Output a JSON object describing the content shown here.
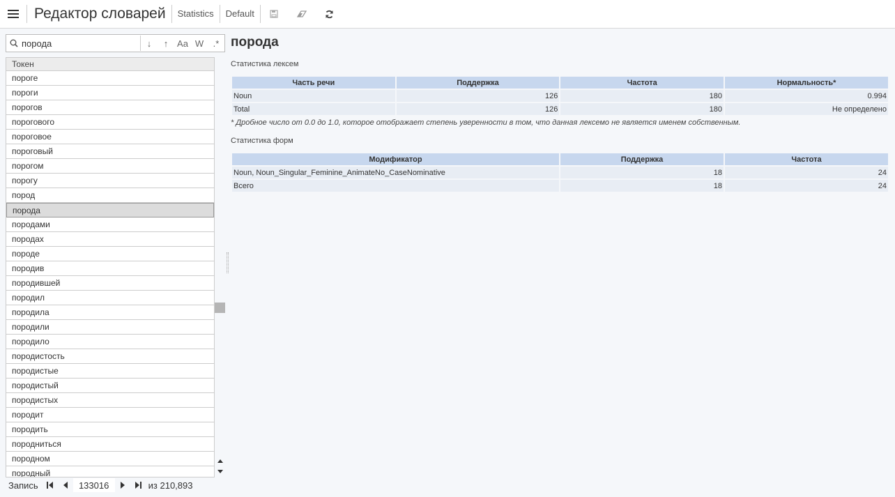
{
  "app": {
    "title": "Редактор словарей"
  },
  "nav": {
    "statistics": "Statistics",
    "default": "Default"
  },
  "icons": {
    "menu": "hamburger-icon",
    "save": "save-icon",
    "erase": "eraser-icon",
    "refresh": "refresh-icon",
    "search": "search-icon"
  },
  "search": {
    "value": "порода",
    "opt_down": "↓",
    "opt_up": "↑",
    "opt_case": "Aa",
    "opt_word": "W",
    "opt_regex": ".*"
  },
  "token_list": {
    "header": "Токен",
    "items": [
      "пороге",
      "пороги",
      "порогов",
      "порогового",
      "пороговое",
      "пороговый",
      "порогом",
      "порогу",
      "пород",
      "порода",
      "породами",
      "породах",
      "породе",
      "породив",
      "породившей",
      "породил",
      "породила",
      "породили",
      "породило",
      "породистость",
      "породистые",
      "породистый",
      "породистых",
      "породит",
      "породить",
      "породниться",
      "породном",
      "породный"
    ],
    "selected_index": 9
  },
  "pager": {
    "label": "Запись",
    "current": "133016",
    "total": "из 210,893"
  },
  "detail": {
    "word": "порода",
    "lexeme_stats": {
      "label": "Статистика лексем",
      "columns": [
        "Часть речи",
        "Поддержка",
        "Частота",
        "Нормальность*"
      ],
      "rows": [
        [
          "Noun",
          "126",
          "180",
          "0.994"
        ],
        [
          "Total",
          "126",
          "180",
          "Не определено"
        ]
      ]
    },
    "footnote": "* Дробное число от 0.0 до 1.0, которое отображает степень уверенности в том, что данная лексемо не является именем собственным.",
    "form_stats": {
      "label": "Статистика форм",
      "columns": [
        "Модификатор",
        "Поддержка",
        "Частота"
      ],
      "rows": [
        [
          "Noun, Noun_Singular_Feminine_AnimateNo_CaseNominative",
          "18",
          "24"
        ],
        [
          "Всего",
          "18",
          "24"
        ]
      ]
    }
  },
  "colors": {
    "header_bg": "#c7d7ee",
    "cell_bg": "#e8edf4",
    "selected_row": "#dcdcdc"
  }
}
